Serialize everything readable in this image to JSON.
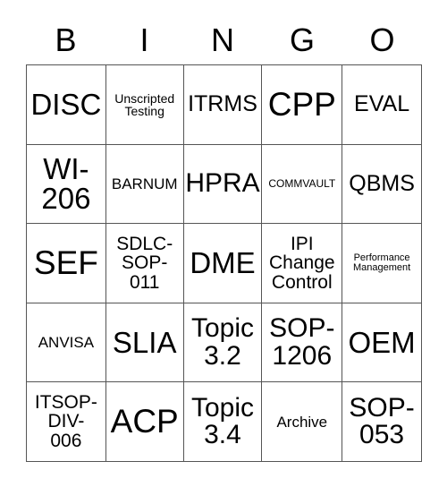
{
  "card": {
    "title": "BINGO",
    "headers": [
      "B",
      "I",
      "N",
      "G",
      "O"
    ],
    "rows": [
      [
        {
          "text": "DISC"
        },
        {
          "text": "Unscripted\nTesting"
        },
        {
          "text": "ITRMS"
        },
        {
          "text": "CPP"
        },
        {
          "text": "EVAL"
        }
      ],
      [
        {
          "text": "WI-\n206"
        },
        {
          "text": "BARNUM"
        },
        {
          "text": "HPRA"
        },
        {
          "text": "COMMVAULT"
        },
        {
          "text": "QBMS"
        }
      ],
      [
        {
          "text": "SEF"
        },
        {
          "text": "SDLC-\nSOP-\n011"
        },
        {
          "text": "DME"
        },
        {
          "text": "IPI\nChange\nControl"
        },
        {
          "text": "Performance\nManagement"
        }
      ],
      [
        {
          "text": "ANVISA"
        },
        {
          "text": "SLIA"
        },
        {
          "text": "Topic\n3.2"
        },
        {
          "text": "SOP-\n1206"
        },
        {
          "text": "OEM"
        }
      ],
      [
        {
          "text": "ITSOP-\nDIV-\n006"
        },
        {
          "text": "ACP"
        },
        {
          "text": "Topic\n3.4"
        },
        {
          "text": "Archive"
        },
        {
          "text": "SOP-\n053"
        }
      ]
    ],
    "colors": {
      "background": "#ffffff",
      "text": "#000000",
      "grid_line": "#555555"
    }
  }
}
